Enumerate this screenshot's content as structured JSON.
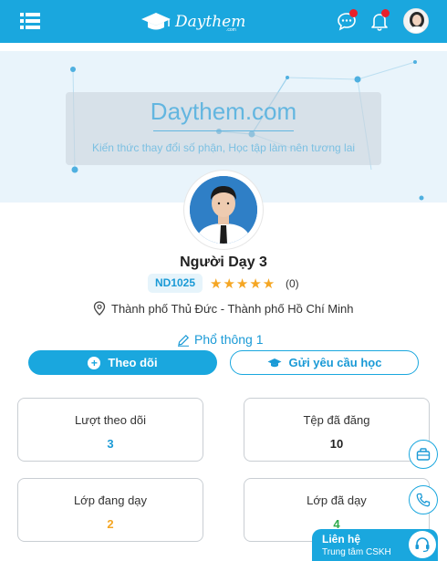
{
  "header": {
    "logo_text": "Daythem",
    "logo_sub": ".com",
    "colors": {
      "brand": "#1aa7de",
      "badge_dot": "#e8202a"
    },
    "icons": [
      "menu-icon",
      "chat-icon",
      "bell-icon",
      "user-avatar"
    ]
  },
  "cover": {
    "title": "Daythem.com",
    "subtitle": "Kiến thức thay đổi số phận, Học tập làm nên tương lai"
  },
  "profile": {
    "name": "Người Dạy 3",
    "code": "ND1025",
    "rating": 5,
    "stars": "★★★★★",
    "review_count": "(0)",
    "location": "Thành phố Thủ Đức - Thành phố Hồ Chí Minh",
    "education_level": "Phổ thông 1"
  },
  "actions": {
    "follow_label": "Theo dõi",
    "request_label": "Gửi yêu cầu học"
  },
  "stats": [
    {
      "label": "Lượt theo dõi",
      "value": "3",
      "color": "#1a9ad6"
    },
    {
      "label": "Tệp đã đăng",
      "value": "10",
      "color": "#222222"
    },
    {
      "label": "Lớp đang dạy",
      "value": "2",
      "color": "#f5a623"
    },
    {
      "label": "Lớp đã dạy",
      "value": "4",
      "color": "#2eaa4a"
    }
  ],
  "contact": {
    "title": "Liên hệ",
    "subtitle": "Trung tâm CSKH"
  }
}
